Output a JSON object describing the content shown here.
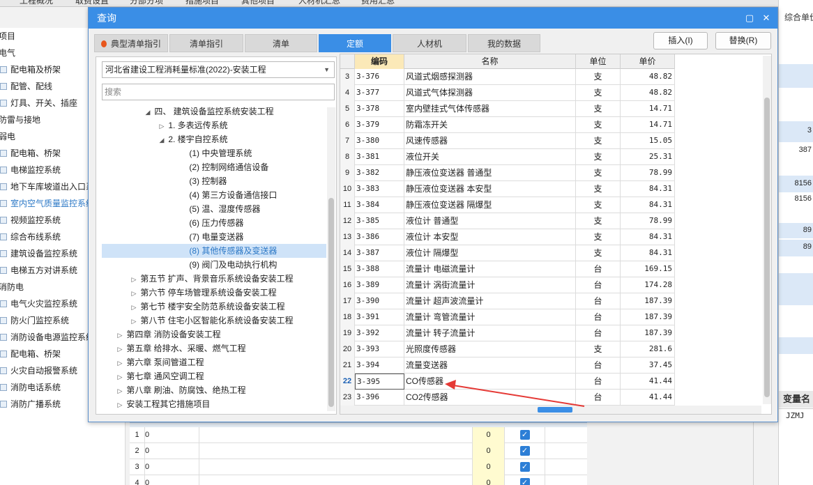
{
  "bg_tabs": [
    "工程概况",
    "取费设置",
    "分部分项",
    "措施项目",
    "其他项目",
    "人材机汇总",
    "费用汇总"
  ],
  "bg_tree": [
    "项目",
    "电气",
    "配电箱及桥架",
    "配管、配线",
    "灯具、开关、插座",
    "防雷与接地",
    "弱电",
    "配电箱、桥架",
    "电梯监控系统",
    "地下车库坡道出入口系",
    "室内空气质量监控系统",
    "视频监控系统",
    "综合布线系统",
    "建筑设备监控系统",
    "电梯五方对讲系统",
    "消防电",
    "电气火灾监控系统",
    "防火门监控系统",
    "消防设备电源监控系统",
    "配电箱、桥架",
    "火灾自动报警系统",
    "消防电话系统",
    "消防广播系统"
  ],
  "bg_right": {
    "header": "综合单价",
    "numbers": [
      "3",
      "387",
      "8156",
      "8156",
      "89",
      "89"
    ],
    "var_header": "变量名",
    "var_value": "JZMJ"
  },
  "bg_grid": [
    {
      "idx": "1",
      "val": "0",
      "qty": "0"
    },
    {
      "idx": "2",
      "val": "0",
      "qty": "0"
    },
    {
      "idx": "3",
      "val": "0",
      "qty": "0"
    },
    {
      "idx": "4",
      "val": "0",
      "qty": "0"
    }
  ],
  "dialog": {
    "title": "查询",
    "tabs": [
      "典型清单指引",
      "清单指引",
      "清单",
      "定额",
      "人材机",
      "我的数据"
    ],
    "active_tab": "定额",
    "insert_button": "插入(I)",
    "replace_button": "替换(R)",
    "standard_select": "河北省建设工程消耗量标准(2022)-安装工程",
    "search_placeholder": "搜索",
    "tree": [
      {
        "label": "四、 建筑设备监控系统安装工程",
        "toggle": "◢"
      },
      {
        "label": "1. 多表远传系统",
        "toggle": "▷"
      },
      {
        "label": "2. 楼宇自控系统",
        "toggle": "◢"
      },
      {
        "label": "(1) 中央管理系统",
        "toggle": ""
      },
      {
        "label": "(2) 控制网络通信设备",
        "toggle": ""
      },
      {
        "label": "(3) 控制器",
        "toggle": ""
      },
      {
        "label": "(4) 第三方设备通信接口",
        "toggle": ""
      },
      {
        "label": "(5) 温、湿度传感器",
        "toggle": ""
      },
      {
        "label": "(6) 压力传感器",
        "toggle": ""
      },
      {
        "label": "(7) 电量变送器",
        "toggle": ""
      },
      {
        "label": "(8) 其他传感器及变送器",
        "toggle": "",
        "selected": true
      },
      {
        "label": "(9) 阀门及电动执行机构",
        "toggle": ""
      },
      {
        "label": "第五节 扩声、背景音乐系统设备安装工程",
        "toggle": "▷"
      },
      {
        "label": "第六节 停车场管理系统设备安装工程",
        "toggle": "▷"
      },
      {
        "label": "第七节 楼宇安全防范系统设备安装工程",
        "toggle": "▷"
      },
      {
        "label": "第八节 住宅小区智能化系统设备安装工程",
        "toggle": "▷"
      },
      {
        "label": "第四章 消防设备安装工程",
        "toggle": "▷"
      },
      {
        "label": "第五章 给排水、采暖、燃气工程",
        "toggle": "▷"
      },
      {
        "label": "第六章 泵间管道工程",
        "toggle": "▷"
      },
      {
        "label": "第七章 通风空调工程",
        "toggle": "▷"
      },
      {
        "label": "第八章 刷油、防腐蚀、绝热工程",
        "toggle": "▷"
      },
      {
        "label": "安装工程其它措施项目",
        "toggle": "▷"
      }
    ],
    "grid": {
      "headers": [
        "",
        "编码",
        "名称",
        "单位",
        "单价"
      ],
      "rows": [
        {
          "idx": "3",
          "code": "3-376",
          "name": "风道式烟感探测器",
          "unit": "支",
          "price": "48.82"
        },
        {
          "idx": "4",
          "code": "3-377",
          "name": "风道式气体探测器",
          "unit": "支",
          "price": "48.82"
        },
        {
          "idx": "5",
          "code": "3-378",
          "name": "室内壁挂式气体传感器",
          "unit": "支",
          "price": "14.71"
        },
        {
          "idx": "6",
          "code": "3-379",
          "name": "防霜冻开关",
          "unit": "支",
          "price": "14.71"
        },
        {
          "idx": "7",
          "code": "3-380",
          "name": "风速传感器",
          "unit": "支",
          "price": "15.05"
        },
        {
          "idx": "8",
          "code": "3-381",
          "name": "液位开关",
          "unit": "支",
          "price": "25.31"
        },
        {
          "idx": "9",
          "code": "3-382",
          "name": "静压液位变送器 普通型",
          "unit": "支",
          "price": "78.99"
        },
        {
          "idx": "10",
          "code": "3-383",
          "name": "静压液位变送器 本安型",
          "unit": "支",
          "price": "84.31"
        },
        {
          "idx": "11",
          "code": "3-384",
          "name": "静压液位变送器 隔爆型",
          "unit": "支",
          "price": "84.31"
        },
        {
          "idx": "12",
          "code": "3-385",
          "name": "液位计 普通型",
          "unit": "支",
          "price": "78.99"
        },
        {
          "idx": "13",
          "code": "3-386",
          "name": "液位计 本安型",
          "unit": "支",
          "price": "84.31"
        },
        {
          "idx": "14",
          "code": "3-387",
          "name": "液位计 隔爆型",
          "unit": "支",
          "price": "84.31"
        },
        {
          "idx": "15",
          "code": "3-388",
          "name": "流量计 电磁流量计",
          "unit": "台",
          "price": "169.15"
        },
        {
          "idx": "16",
          "code": "3-389",
          "name": "流量计 涡街流量计",
          "unit": "台",
          "price": "174.28"
        },
        {
          "idx": "17",
          "code": "3-390",
          "name": "流量计 超声波流量计",
          "unit": "台",
          "price": "187.39"
        },
        {
          "idx": "18",
          "code": "3-391",
          "name": "流量计 弯管流量计",
          "unit": "台",
          "price": "187.39"
        },
        {
          "idx": "19",
          "code": "3-392",
          "name": "流量计 转子流量计",
          "unit": "台",
          "price": "187.39"
        },
        {
          "idx": "20",
          "code": "3-393",
          "name": "光照度传感器",
          "unit": "支",
          "price": "281.6"
        },
        {
          "idx": "21",
          "code": "3-394",
          "name": "流量变送器",
          "unit": "台",
          "price": "37.45"
        },
        {
          "idx": "22",
          "code": "3-395",
          "name": "CO传感器",
          "unit": "台",
          "price": "41.44",
          "current": true
        },
        {
          "idx": "23",
          "code": "3-396",
          "name": "CO2传感器",
          "unit": "台",
          "price": "41.44"
        }
      ]
    }
  },
  "colors": {
    "accent": "#3a8ee6",
    "annotation_arrow": "#e53935",
    "code_header": "#fbe9b8"
  }
}
